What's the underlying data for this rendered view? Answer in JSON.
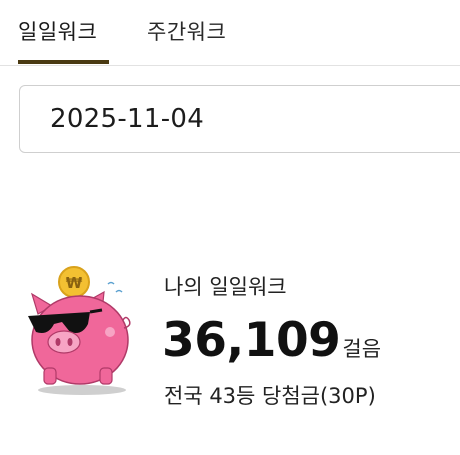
{
  "tabs": [
    {
      "label": "일일워크",
      "active": true
    },
    {
      "label": "주간워크",
      "active": false
    }
  ],
  "date_picker": {
    "value": "2025-11-04"
  },
  "summary": {
    "title": "나의 일일워크",
    "steps": "36,109",
    "steps_unit": "걸음",
    "rank_text": "전국 43등 당첨금(30P)"
  },
  "mascot": {
    "icon": "piggy-bank-sunglasses-icon",
    "coin_symbol": "₩",
    "colors": {
      "pig": "#f0679a",
      "snout": "#f7a4c4",
      "coin": "#f3c032",
      "shadow": "#cfcfcf"
    }
  },
  "colors": {
    "tab_indicator": "#4a3a12",
    "text": "#222222",
    "border": "#cfcfcf"
  }
}
